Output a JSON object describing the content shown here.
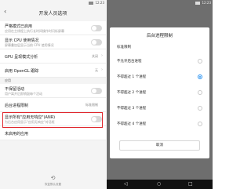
{
  "left": {
    "status_time": "12:23",
    "title": "开发人员选项",
    "rows": [
      {
        "title": "严格模式已启用",
        "subtitle": "应用在主线程上执行长时间操作时闪烁屏幕"
      },
      {
        "title": "显示 CPU 使用情况",
        "subtitle": "屏幕叠加层显示当前 CPU 使用情况"
      },
      {
        "title": "GPU 呈现模式分析",
        "value": "关闭"
      },
      {
        "title": "启用 OpenGL 跟踪",
        "value": "无"
      }
    ],
    "section_apps": "应用",
    "app_rows": [
      {
        "title": "不保留活动",
        "subtitle": "用户离开后即销毁每个活动"
      },
      {
        "title": "后台进程限制",
        "value": "标准限制"
      },
      {
        "title": "显示所有\"应用无响应\"(ANR)",
        "subtitle": "为后台应用显示\"应用无响应\"对话框"
      },
      {
        "title": "未启用的应用"
      }
    ],
    "bottom_label": "恢复默认设置"
  },
  "right": {
    "status_time": "12:23",
    "dialog_title": "后台进程限制",
    "options": [
      {
        "label": "标准限制",
        "selected": false
      },
      {
        "label": "不允许后台进程",
        "selected": false
      },
      {
        "label": "不得超过 1 个进程",
        "selected": true
      },
      {
        "label": "不得超过 2 个进程",
        "selected": false
      },
      {
        "label": "不得超过 3 个进程",
        "selected": false
      },
      {
        "label": "不得超过 4 个进程",
        "selected": false
      }
    ],
    "cancel": "取消"
  },
  "colors": {
    "accent": "#1f8ef1",
    "highlight": "#e0282e"
  }
}
